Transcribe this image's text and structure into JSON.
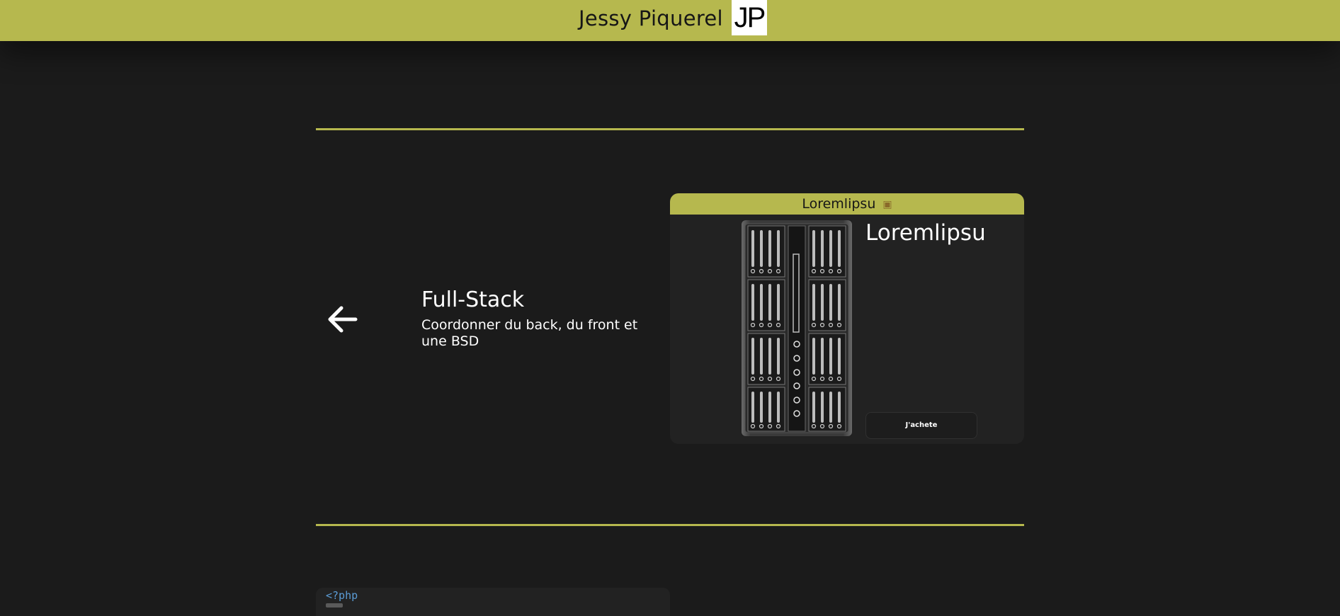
{
  "header": {
    "name": "Jessy Piquerel",
    "logo_text": "JP",
    "accent_color": "#b6b84e"
  },
  "project": {
    "back_icon": "arrow-left-icon",
    "title": "Full-Stack",
    "description": "Coordonner du back, du front et une BSD"
  },
  "product_card": {
    "header_label": "Loremlipsu",
    "header_icon": "shopping-bag-icon",
    "product_title": "Loremlipsu",
    "product_image_alt": "screwdriver-bit-set-image",
    "buy_button_label": "J'achete"
  },
  "code_preview": {
    "first_line": "<?php"
  }
}
